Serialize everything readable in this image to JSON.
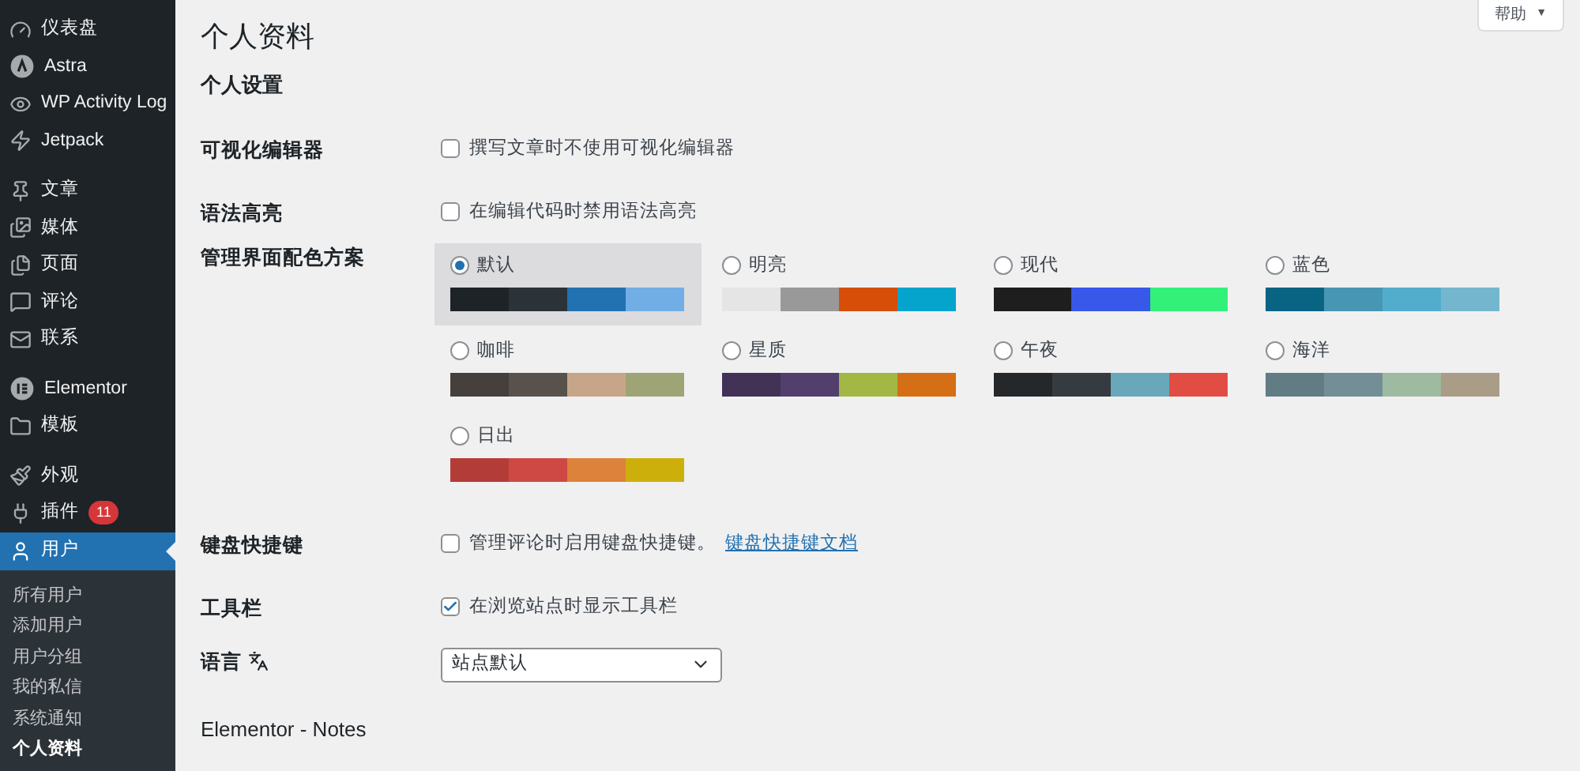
{
  "sidebar": {
    "groups": [
      [
        {
          "label": "仪表盘",
          "selected": false
        },
        {
          "label": "Astra",
          "selected": false
        },
        {
          "label": "WP Activity Log",
          "selected": false
        },
        {
          "label": "Jetpack",
          "selected": false
        }
      ],
      [
        {
          "label": "文章",
          "selected": false
        },
        {
          "label": "媒体",
          "selected": false
        },
        {
          "label": "页面",
          "selected": false
        },
        {
          "label": "评论",
          "selected": false
        },
        {
          "label": "联系",
          "selected": false
        }
      ],
      [
        {
          "label": "Elementor",
          "selected": false
        },
        {
          "label": "模板",
          "selected": false
        }
      ],
      [
        {
          "label": "外观",
          "selected": false
        },
        {
          "label": "插件",
          "badge": "11",
          "selected": false
        },
        {
          "label": "用户",
          "selected": true
        }
      ]
    ],
    "submenu": [
      {
        "label": "所有用户",
        "selected": false
      },
      {
        "label": "添加用户",
        "selected": false
      },
      {
        "label": "用户分组",
        "selected": false
      },
      {
        "label": "我的私信",
        "selected": false
      },
      {
        "label": "系统通知",
        "selected": false
      },
      {
        "label": "个人资料",
        "selected": true
      }
    ]
  },
  "help_button": {
    "label": "帮助",
    "caret": "▼"
  },
  "page_title": "个人资料",
  "section_title": "个人设置",
  "rows": [
    {
      "kind": "checkbox",
      "label": "可视化编辑器",
      "text": "撰写文章时不使用可视化编辑器",
      "checked": false
    },
    {
      "kind": "checkbox",
      "label": "语法高亮",
      "text": "在编辑代码时禁用语法高亮",
      "checked": false
    },
    {
      "kind": "schemes",
      "label": "管理界面配色方案",
      "schemes": [
        {
          "name": "默认",
          "selected": true,
          "swatches": [
            {
              "color": "#1d2327"
            },
            {
              "color": "#2c3338"
            },
            {
              "color": "#2271b1"
            },
            {
              "color": "#72aee6"
            }
          ]
        },
        {
          "name": "明亮",
          "selected": false,
          "swatches": [
            {
              "color": "#e5e5e5"
            },
            {
              "color": "#999999"
            },
            {
              "color": "#d64e07"
            },
            {
              "color": "#04a4cc"
            }
          ]
        },
        {
          "name": "现代",
          "selected": false,
          "swatches": [
            {
              "color": "#1e1e1e"
            },
            {
              "color": "#3858e9"
            },
            {
              "color": "#33f078"
            }
          ]
        },
        {
          "name": "蓝色",
          "selected": false,
          "swatches": [
            {
              "color": "#096484"
            },
            {
              "color": "#4796b3"
            },
            {
              "color": "#52accc"
            },
            {
              "color": "#74b6ce"
            }
          ]
        },
        {
          "name": "咖啡",
          "selected": false,
          "swatches": [
            {
              "color": "#46403c"
            },
            {
              "color": "#59524c"
            },
            {
              "color": "#c7a589"
            },
            {
              "color": "#9ea476"
            }
          ]
        },
        {
          "name": "星质",
          "selected": false,
          "swatches": [
            {
              "color": "#413256"
            },
            {
              "color": "#523f6d"
            },
            {
              "color": "#a3b745"
            },
            {
              "color": "#d46f15"
            }
          ]
        },
        {
          "name": "午夜",
          "selected": false,
          "swatches": [
            {
              "color": "#25282b"
            },
            {
              "color": "#363b3f"
            },
            {
              "color": "#69a8bb"
            },
            {
              "color": "#e14d43"
            }
          ]
        },
        {
          "name": "海洋",
          "selected": false,
          "swatches": [
            {
              "color": "#627c83"
            },
            {
              "color": "#738e96"
            },
            {
              "color": "#9ebaa0"
            },
            {
              "color": "#aa9d88"
            }
          ]
        },
        {
          "name": "日出",
          "selected": false,
          "swatches": [
            {
              "color": "#b43c38"
            },
            {
              "color": "#cf4944"
            },
            {
              "color": "#dd823b"
            },
            {
              "color": "#ccaf0b"
            }
          ]
        }
      ]
    },
    {
      "kind": "checkbox",
      "label": "键盘快捷键",
      "text": "管理评论时启用键盘快捷键。",
      "link": "键盘快捷键文档",
      "checked": false
    },
    {
      "kind": "checkbox",
      "label": "工具栏",
      "text": "在浏览站点时显示工具栏",
      "checked": true
    },
    {
      "kind": "select",
      "label": "语言",
      "value": "站点默认"
    }
  ],
  "next_section": "Elementor - Notes"
}
